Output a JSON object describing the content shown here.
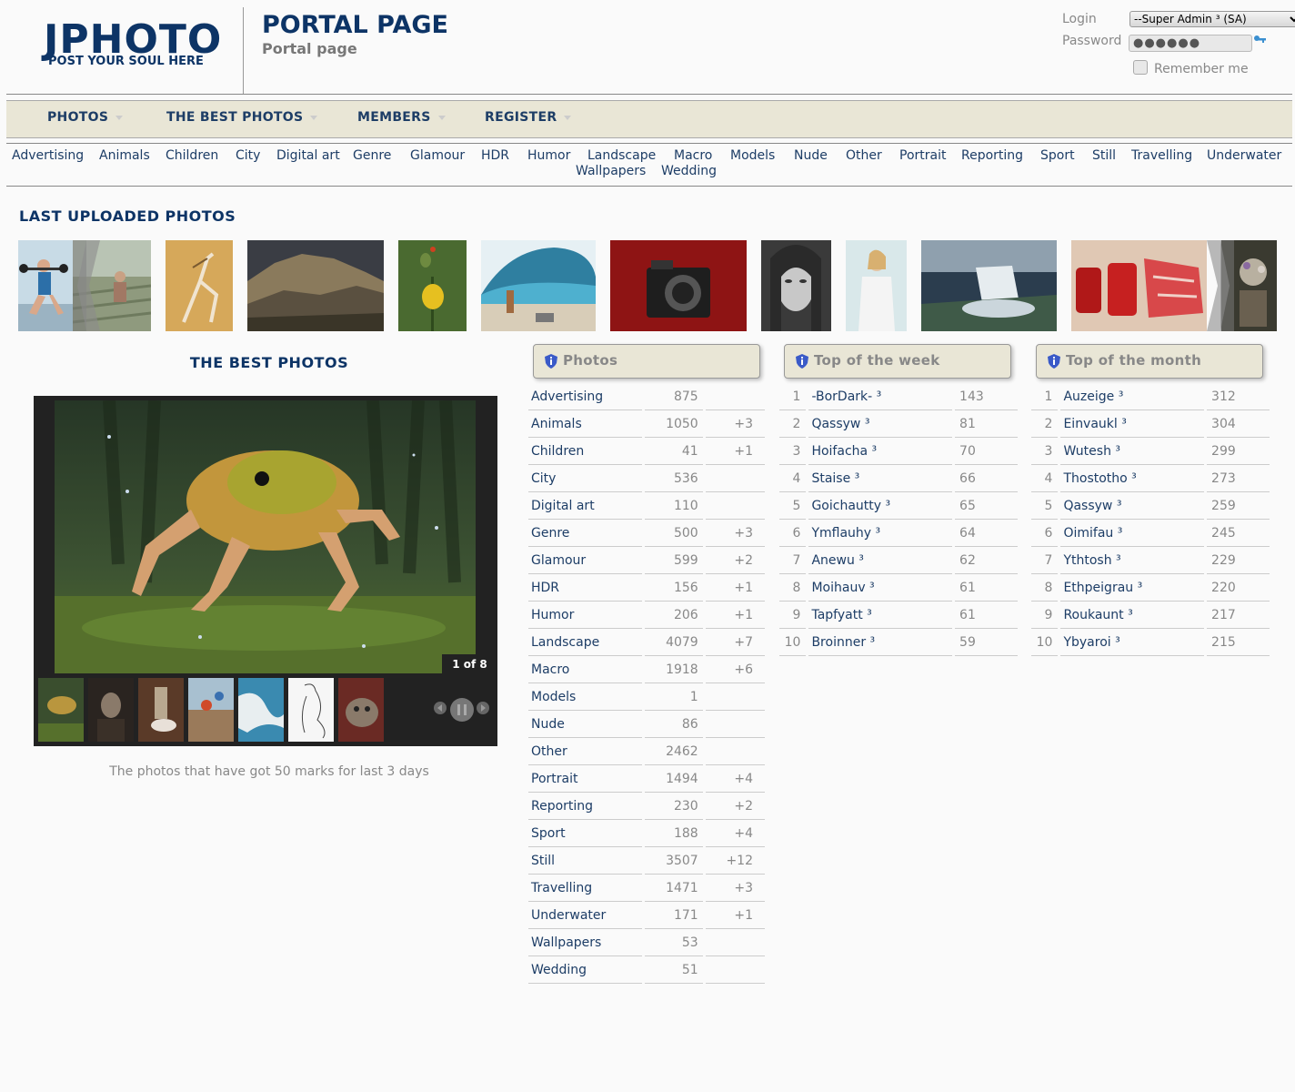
{
  "header": {
    "logo_title": "JPHOTO",
    "logo_sub": "POST YOUR SOUL HERE",
    "page_title": "PORTAL PAGE",
    "page_sub": "Portal page"
  },
  "login": {
    "login_label": "Login",
    "password_label": "Password",
    "user_selected": "--Super Admin ³ (SA)",
    "password_mask": "●●●●●●",
    "remember_label": "Remember me"
  },
  "menu": {
    "items": [
      "PHOTOS",
      "THE BEST PHOTOS",
      "MEMBERS",
      "REGISTER"
    ]
  },
  "categories": [
    "Advertising",
    "Animals",
    "Children",
    "City",
    "Digital art",
    "Genre",
    "Glamour",
    "HDR",
    "Humor",
    "Landscape",
    "Macro",
    "Models",
    "Nude",
    "Other",
    "Portrait",
    "Reporting",
    "Sport",
    "Still",
    "Travelling",
    "Underwater",
    "Wallpapers",
    "Wedding"
  ],
  "last_uploaded": {
    "title": "LAST UPLOADED PHOTOS"
  },
  "best": {
    "title": "THE BEST PHOTOS",
    "counter": "1 of 8",
    "caption": "The photos that have got 50 marks for last 3 days"
  },
  "photos_box": {
    "title": "Photos",
    "rows": [
      {
        "name": "Advertising",
        "count": "875",
        "delta": ""
      },
      {
        "name": "Animals",
        "count": "1050",
        "delta": "+3"
      },
      {
        "name": "Children",
        "count": "41",
        "delta": "+1"
      },
      {
        "name": "City",
        "count": "536",
        "delta": ""
      },
      {
        "name": "Digital art",
        "count": "110",
        "delta": ""
      },
      {
        "name": "Genre",
        "count": "500",
        "delta": "+3"
      },
      {
        "name": "Glamour",
        "count": "599",
        "delta": "+2"
      },
      {
        "name": "HDR",
        "count": "156",
        "delta": "+1"
      },
      {
        "name": "Humor",
        "count": "206",
        "delta": "+1"
      },
      {
        "name": "Landscape",
        "count": "4079",
        "delta": "+7"
      },
      {
        "name": "Macro",
        "count": "1918",
        "delta": "+6"
      },
      {
        "name": "Models",
        "count": "1",
        "delta": ""
      },
      {
        "name": "Nude",
        "count": "86",
        "delta": ""
      },
      {
        "name": "Other",
        "count": "2462",
        "delta": ""
      },
      {
        "name": "Portrait",
        "count": "1494",
        "delta": "+4"
      },
      {
        "name": "Reporting",
        "count": "230",
        "delta": "+2"
      },
      {
        "name": "Sport",
        "count": "188",
        "delta": "+4"
      },
      {
        "name": "Still",
        "count": "3507",
        "delta": "+12"
      },
      {
        "name": "Travelling",
        "count": "1471",
        "delta": "+3"
      },
      {
        "name": "Underwater",
        "count": "171",
        "delta": "+1"
      },
      {
        "name": "Wallpapers",
        "count": "53",
        "delta": ""
      },
      {
        "name": "Wedding",
        "count": "51",
        "delta": ""
      }
    ]
  },
  "week_box": {
    "title": "Top of the week",
    "rows": [
      {
        "rank": "1",
        "name": "-BorDark- ³",
        "score": "143"
      },
      {
        "rank": "2",
        "name": "Qassyw ³",
        "score": "81"
      },
      {
        "rank": "3",
        "name": "Hoifacha ³",
        "score": "70"
      },
      {
        "rank": "4",
        "name": "Staise ³",
        "score": "66"
      },
      {
        "rank": "5",
        "name": "Goichautty ³",
        "score": "65"
      },
      {
        "rank": "6",
        "name": "Ymflauhy ³",
        "score": "64"
      },
      {
        "rank": "7",
        "name": "Anewu ³",
        "score": "62"
      },
      {
        "rank": "8",
        "name": "Moihauv ³",
        "score": "61"
      },
      {
        "rank": "9",
        "name": "Tapfyatt ³",
        "score": "61"
      },
      {
        "rank": "10",
        "name": "Broinner ³",
        "score": "59"
      }
    ]
  },
  "month_box": {
    "title": "Top of the month",
    "rows": [
      {
        "rank": "1",
        "name": "Auzeige ³",
        "score": "312"
      },
      {
        "rank": "2",
        "name": "Einvaukl ³",
        "score": "304"
      },
      {
        "rank": "3",
        "name": "Wutesh ³",
        "score": "299"
      },
      {
        "rank": "4",
        "name": "Thostotho ³",
        "score": "273"
      },
      {
        "rank": "5",
        "name": "Qassyw ³",
        "score": "259"
      },
      {
        "rank": "6",
        "name": "Oimifau ³",
        "score": "245"
      },
      {
        "rank": "7",
        "name": "Ythtosh ³",
        "score": "229"
      },
      {
        "rank": "8",
        "name": "Ethpeigrau ³",
        "score": "220"
      },
      {
        "rank": "9",
        "name": "Roukaunt ³",
        "score": "217"
      },
      {
        "rank": "10",
        "name": "Ybyaroi ³",
        "score": "215"
      }
    ]
  }
}
